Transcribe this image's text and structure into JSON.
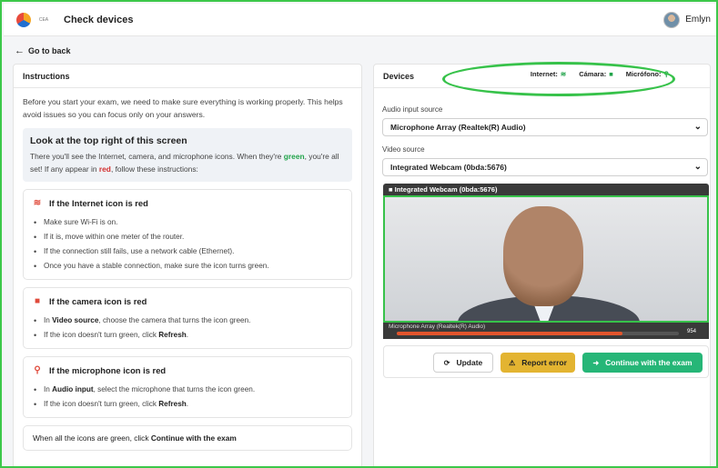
{
  "app": {
    "title": "Check devices",
    "logo_text": "CEA"
  },
  "user": {
    "name": "Emlyn"
  },
  "nav": {
    "back_label": "Go to back"
  },
  "left": {
    "header": "Instructions",
    "intro": "Before you start your exam, we need to make sure everything is working properly. This helps avoid issues so you can focus only on your answers.",
    "callout": {
      "title": "Look at the top right of this screen",
      "text_1": "There you'll see the Internet, camera, and microphone icons. When they're ",
      "green": "green",
      "text_2": ", you're all set! If any appear in ",
      "red": "red",
      "text_3": ", follow these instructions:"
    },
    "internet": {
      "title": "If the Internet icon is red",
      "items": [
        "Make sure Wi-Fi is on.",
        "If it is, move within one meter of the router.",
        "If the connection still fails, use a network cable (Ethernet).",
        "Once you have a stable connection, make sure the icon turns green."
      ]
    },
    "camera": {
      "title": "If the camera icon is red",
      "item1_a": "In ",
      "item1_b": "Video source",
      "item1_c": ", choose the camera that turns the icon green.",
      "item2_a": "If the icon doesn't turn green, click ",
      "item2_b": "Refresh",
      "item2_c": "."
    },
    "microphone": {
      "title": "If the microphone icon is red",
      "item1_a": "In ",
      "item1_b": "Audio input",
      "item1_c": ", select the microphone that turns the icon green.",
      "item2_a": "If the icon doesn't turn green, click ",
      "item2_b": "Refresh",
      "item2_c": "."
    },
    "final": {
      "text": "When all the icons are green, click ",
      "bold": "Continue with the exam"
    }
  },
  "right": {
    "header": "Devices",
    "status": {
      "internet": "Internet:",
      "camera": "Cámara:",
      "microphone": "Micrófono:"
    },
    "audio_label": "Audio input source",
    "audio_value": "Microphone Array (Realtek(R) Audio)",
    "video_label": "Video source",
    "video_value": "Integrated Webcam (0bda:5676)",
    "video_title": "Integrated Webcam (0bda:5676)",
    "mic_title": "Microphone Array (Realtek(R) Audio)",
    "mic_level_text": "954",
    "mic_level": 0.8,
    "buttons": {
      "update": "Update",
      "report": "Report error",
      "continue": "Continue with the exam"
    }
  },
  "colors": {
    "accent": "#26b677",
    "ok": "#21a34a",
    "alert": "#d32f2f",
    "report": "#e3b431",
    "highlight": "#37c24a"
  },
  "icons": [
    "wifi-icon",
    "camera-icon",
    "microphone-icon",
    "arrow-left-icon",
    "chevron-down-icon",
    "refresh-icon",
    "warning-icon"
  ]
}
